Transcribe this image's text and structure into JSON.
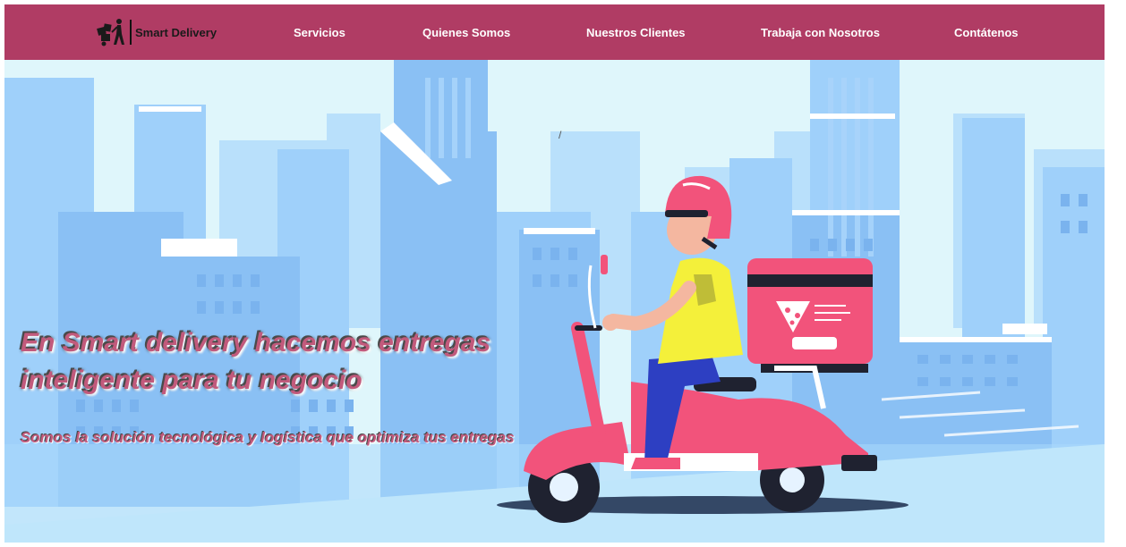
{
  "brand": {
    "name": "Smart Delivery",
    "logo_icon": "delivery-person-with-boxes-icon"
  },
  "nav": {
    "links": [
      {
        "label": "Servicios"
      },
      {
        "label": "Quienes Somos"
      },
      {
        "label": "Nuestros Clientes"
      },
      {
        "label": "Trabaja con Nosotros"
      },
      {
        "label": "Contátenos"
      }
    ]
  },
  "hero": {
    "title": "En Smart delivery hacemos entregas inteligente para tu negocio",
    "subtitle": "Somos la solución tecnológica y logística que optimiza tus entregas",
    "artifact": "/",
    "illustration": "scooter-delivery-rider-illustration"
  },
  "colors": {
    "navbar": "#b03c64",
    "nav_text": "#ffffff",
    "accent_pink": "#f2537b",
    "sky": "#dff6fb",
    "buildings": "#8fc4f5"
  }
}
